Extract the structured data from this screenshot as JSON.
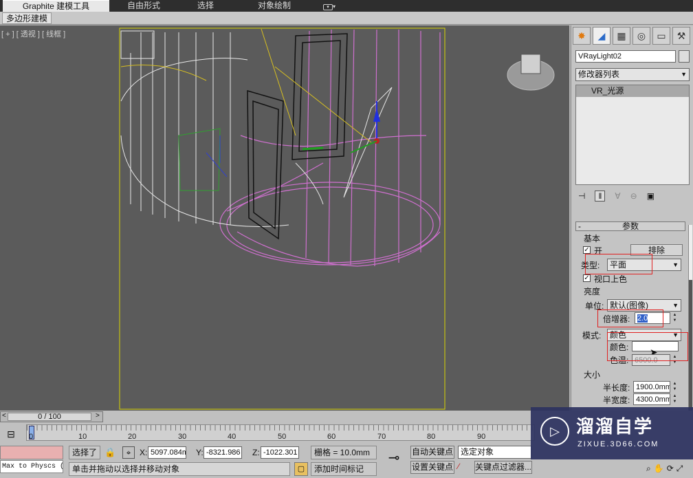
{
  "ribbon": {
    "tabs": [
      "Graphite 建模工具",
      "自由形式",
      "选择",
      "对象绘制"
    ],
    "extra_icon": "dropdown-menu-icon",
    "subtab": "多边形建模"
  },
  "viewport": {
    "label": "[ + ] [ 透视 ] [ 线框 ]"
  },
  "command_panel": {
    "object_name": "VRayLight02",
    "modifier_list": "修改器列表",
    "stack_item": "VR_光源",
    "rollout_title": "参数",
    "basic_group": "基本",
    "on_label": "开",
    "exclude_btn": "排除",
    "type_label": "类型:",
    "type_value": "平面",
    "viewport_color_label": "视口上色",
    "brightness_group": "亮度",
    "unit_label": "单位:",
    "unit_value": "默认(图像)",
    "multiplier_label": "倍增器:",
    "multiplier_value": "2.0",
    "mode_label": "模式:",
    "mode_value": "颜色",
    "color_label": "颜色:",
    "temp_label": "色温:",
    "temp_value": "6500.0",
    "size_group": "大小",
    "half_length_label": "半长度:",
    "half_length_value": "1900.0mm",
    "half_width_label": "半宽度:",
    "half_width_value": "4300.0mm",
    "highlight_color": "#e02020",
    "light_color": "#ffffff"
  },
  "timeline": {
    "frame_counter": "0 / 100",
    "ticks": [
      "0",
      "10",
      "20",
      "30",
      "40",
      "50",
      "60",
      "70",
      "80",
      "90"
    ]
  },
  "status": {
    "script_text": "Max to Physcs (",
    "selection": "选择了",
    "x_label": "X:",
    "x_value": "5097.084m",
    "y_label": "Y:",
    "y_value": "-8321.986",
    "z_label": "Z:",
    "z_value": "-1022.301",
    "grid": "栅格 = 10.0mm",
    "auto_key": "自动关键点",
    "selected_object": "选定对象",
    "set_key": "设置关键点",
    "key_filter": "关键点过滤器...",
    "prompt": "单击并拖动以选择并移动对象",
    "add_time_tag": "添加时间标记",
    "frame_field": "0"
  },
  "watermark": {
    "title": "溜溜自学",
    "url": "ZIXUE.3D66.COM"
  }
}
